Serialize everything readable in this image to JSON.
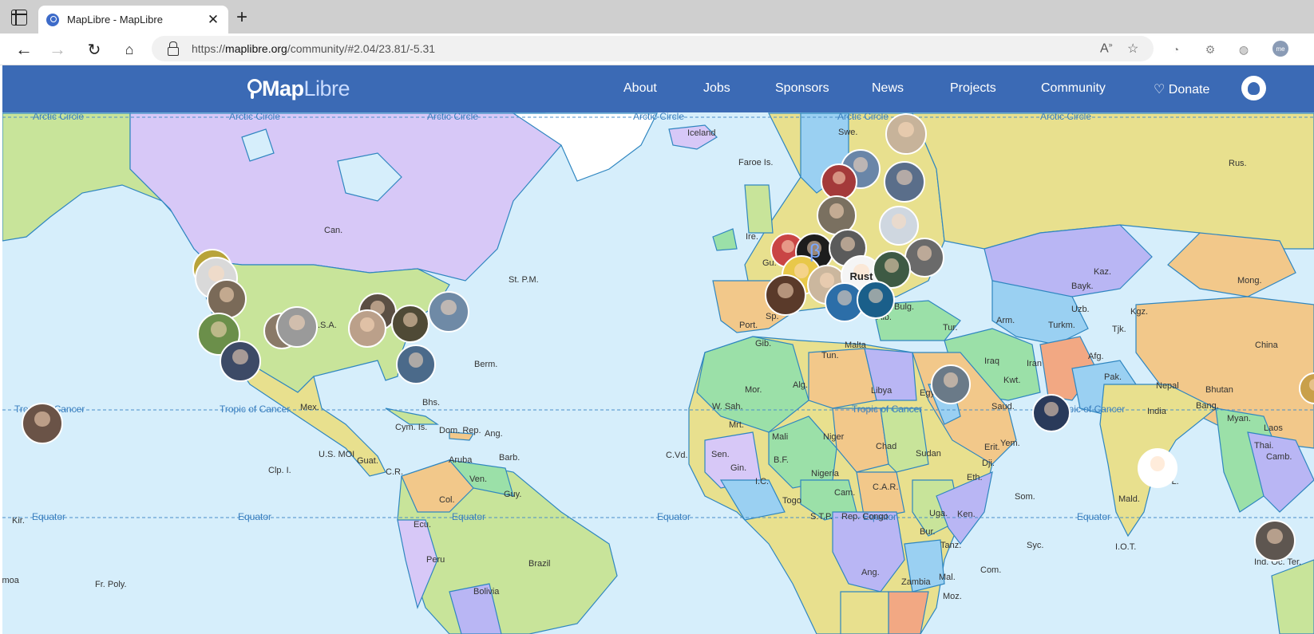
{
  "browser": {
    "tab_title": "MapLibre - MapLibre",
    "url_prefix": "https://",
    "url_host": "maplibre.org",
    "url_path": "/community/#2.04/23.81/-5.31",
    "icons": [
      "tab-actions-icon",
      "close-icon",
      "plus-icon",
      "back-icon",
      "forward-icon",
      "reload-icon",
      "home-icon",
      "lock-icon",
      "read-aloud-icon",
      "favorite-icon",
      "extension-icon",
      "collections-icon",
      "browser-essentials-icon",
      "profile-icon"
    ]
  },
  "site": {
    "logo_bold": "Map",
    "logo_light": "Libre",
    "nav": [
      "About",
      "Jobs",
      "Sponsors",
      "News",
      "Projects",
      "Community",
      "♡ Donate"
    ],
    "colors": {
      "navbar": "#3b6ab5",
      "water": "#d6eefb",
      "lines": "#3a7fbf"
    }
  },
  "map": {
    "latitude_lines": {
      "arctic": "Arctic Circle",
      "cancer": "Tropic of Cancer",
      "equator": "Equator",
      "cancer_left": "Tropic of Cancer"
    },
    "labels": [
      "Iceland",
      "Faroe Is.",
      "Swe.",
      "Rus.",
      "Can.",
      "St. P.M.",
      "Ire.",
      "Gu.",
      "Kaz.",
      "Mong.",
      "Bayk.",
      "Uzb.",
      "Kgz.",
      "Turkm.",
      "Tjk.",
      "China",
      "Afg.",
      "Pak.",
      "Nepal",
      "Bhutan",
      "Bang.",
      "India",
      "Myan.",
      "Laos",
      "Thai.",
      "Camb.",
      "Sri L.",
      "Mald.",
      "I.O.T.",
      "Ind. Oc. Ter.",
      "Port.",
      "Sp.",
      "Gib.",
      "Malta",
      "Tun.",
      "Tur.",
      "Arm.",
      "Bulg.",
      "Alb.",
      "Iraq",
      "Iran",
      "Kwt.",
      "Saud.",
      "Yem.",
      "Mor.",
      "Alg.",
      "Libya",
      "Egypt",
      "W. Sah.",
      "Mrt.",
      "Mali",
      "Niger",
      "Chad",
      "Sudan",
      "Erit.",
      "Dji.",
      "Eth.",
      "Som.",
      "Sen.",
      "Gin.",
      "B.F.",
      "I.C.",
      "Togo",
      "Nigeria",
      "Cam.",
      "C.A.R.",
      "Rep. Congo",
      "Uga.",
      "Ken.",
      "Bur.",
      "Tanz.",
      "Ang.",
      "Zambia",
      "Mal.",
      "Moz.",
      "Com.",
      "Syc.",
      "S.T.P.",
      "C.Vd.",
      "U.S.A.",
      "Berm.",
      "Mex.",
      "Bhs.",
      "Cym. Is.",
      "Dom. Rep.",
      "Ang.",
      "Guat.",
      "Aruba",
      "Barb.",
      "C.R.",
      "Ven.",
      "Guy.",
      "Col.",
      "Ecu.",
      "Peru",
      "Brazil",
      "Bolivia",
      "U.S. MOI",
      "Clp. I.",
      "Kir.",
      "Fr. Poly.",
      "Samoa"
    ],
    "special_avatar_text": "Rust"
  }
}
